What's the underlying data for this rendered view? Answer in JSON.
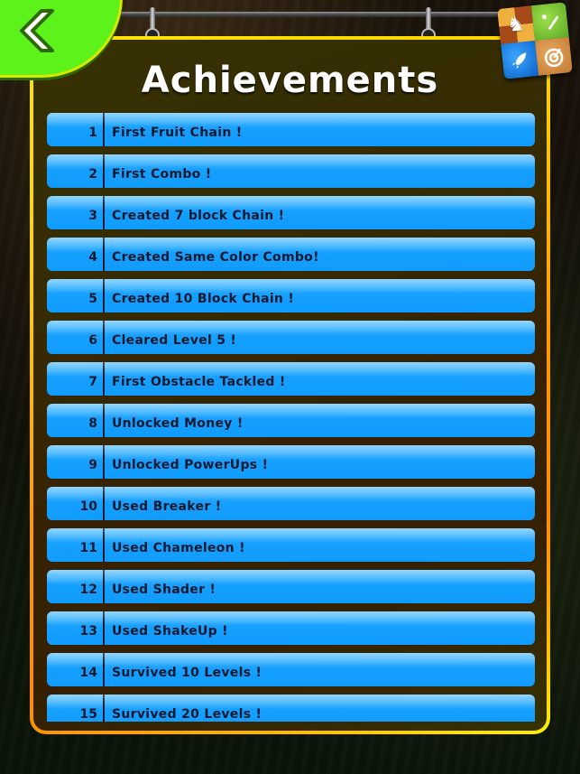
{
  "header": {
    "title": "Achievements",
    "back_button": {
      "icon": "chevron-left-icon"
    },
    "game_center_button": {
      "icon": "game-center-icon",
      "quadrants": [
        "chess-knight-icon",
        "baseball-bat-icon",
        "rocket-icon",
        "target-icon"
      ]
    }
  },
  "colors": {
    "row_fill": "#16a0ff",
    "row_text": "#0a1a2e",
    "frame_top": "#ffe600",
    "frame_mid": "#ff8a00",
    "back_button_green": "#5cf21a"
  },
  "achievements": [
    {
      "number": "1",
      "label": "First Fruit Chain !"
    },
    {
      "number": "2",
      "label": "First Combo !"
    },
    {
      "number": "3",
      "label": "Created 7 block Chain !"
    },
    {
      "number": "4",
      "label": "Created Same Color Combo!"
    },
    {
      "number": "5",
      "label": "Created 10 Block Chain !"
    },
    {
      "number": "6",
      "label": "Cleared Level 5 !"
    },
    {
      "number": "7",
      "label": "First Obstacle Tackled !"
    },
    {
      "number": "8",
      "label": "Unlocked Money !"
    },
    {
      "number": "9",
      "label": "Unlocked PowerUps !"
    },
    {
      "number": "10",
      "label": "Used Breaker !"
    },
    {
      "number": "11",
      "label": "Used Chameleon !"
    },
    {
      "number": "12",
      "label": "Used Shader !"
    },
    {
      "number": "13",
      "label": "Used ShakeUp !"
    },
    {
      "number": "14",
      "label": "Survived 10 Levels !"
    },
    {
      "number": "15",
      "label": "Survived 20 Levels !"
    }
  ]
}
